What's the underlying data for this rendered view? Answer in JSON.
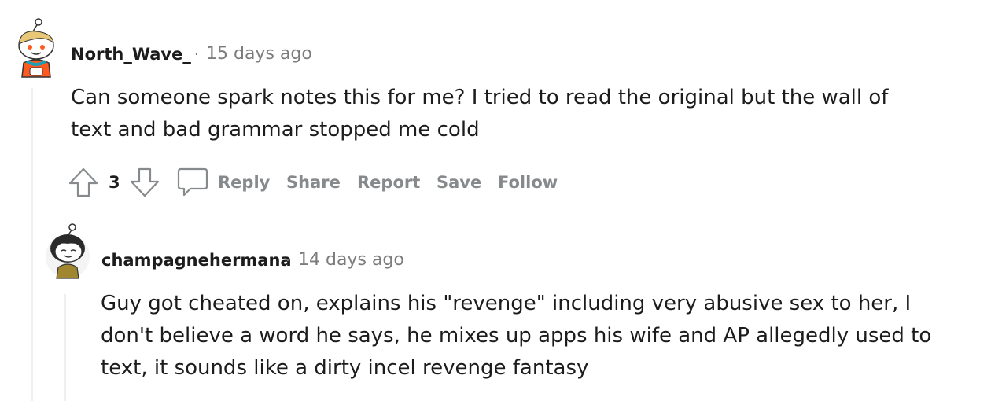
{
  "comment1": {
    "username": "North_Wave_",
    "separator": "·",
    "time": "15 days ago",
    "text": "Can someone spark notes this for me? I tried to read the original but the wall of text and bad grammar stopped me cold",
    "score": "3",
    "actions": {
      "reply": "Reply",
      "share": "Share",
      "report": "Report",
      "save": "Save",
      "follow": "Follow"
    }
  },
  "comment2": {
    "username": "champagnehermana",
    "separator": "·",
    "time": "14 days ago",
    "text": "Guy got cheated on, explains his \"revenge\" including very abusive sex to her, I don't believe a word he says, he mixes up apps his wife and AP allegedly used to text, it sounds like a dirty incel revenge fantasy"
  },
  "colors": {
    "text": "#1c1c1c",
    "meta": "#7c7c7c",
    "action": "#878a8c",
    "thread_line": "#edeff1"
  },
  "icons": [
    "snoo-avatar-icon",
    "snoo-avatar-icon",
    "upvote-arrow-icon",
    "downvote-arrow-icon",
    "comment-bubble-icon"
  ]
}
